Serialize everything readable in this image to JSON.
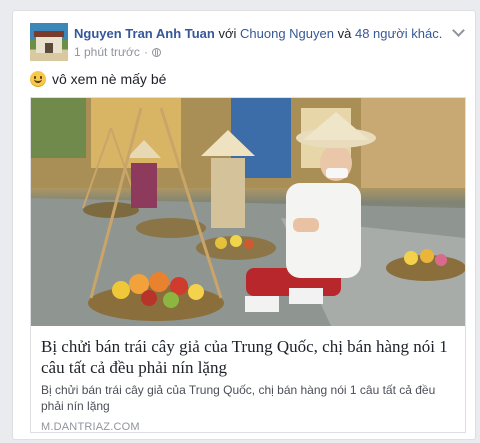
{
  "post": {
    "author": "Nguyen Tran Anh Tuan",
    "with_word": "với",
    "tagged": "Chuong Nguyen",
    "and_word": "và",
    "others": "48 người khác.",
    "time": "1 phút trước",
    "separator": "·",
    "status_text": "vô xem nè mấy bé"
  },
  "link_preview": {
    "headline": "Bị chửi bán trái cây giả của Trung Quốc, chị bán hàng nói 1 câu tất cả đều phải nín lặng",
    "description": "Bị chửi bán trái cây giả của Trung Quốc, chị bán hàng nói 1 câu tất cả đều phải nín lặng",
    "domain": "M.DANTRIAZ.COM"
  },
  "colors": {
    "link": "#365899",
    "page_background": "#e9ebee",
    "meta_text": "#90949c"
  },
  "icons": [
    "globe-icon",
    "chevron-down-icon",
    "smiley-emoji-icon"
  ]
}
